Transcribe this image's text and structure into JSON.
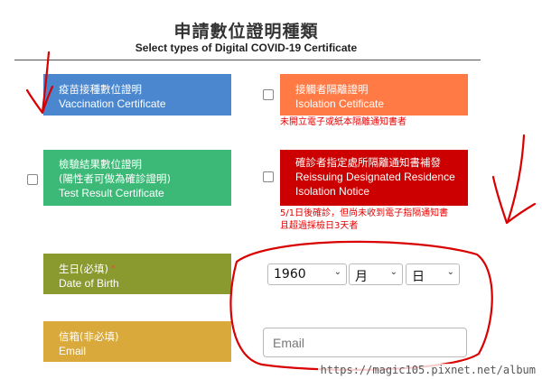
{
  "header": {
    "title_zh": "申請數位證明種類",
    "title_en": "Select types of Digital COVID-19 Certificate"
  },
  "certificates": {
    "vaccination": {
      "zh": "疫苗接種數位證明",
      "en": "Vaccination Certificate",
      "color": "#4a87cf"
    },
    "isolation": {
      "zh": "接觸者隔離證明",
      "en": "Isolation Cetificate",
      "color": "#ff7a45",
      "note": "未開立電子或紙本隔離通知書者"
    },
    "test_result": {
      "zh_line1": "檢驗結果數位證明",
      "zh_line2": "(陽性者可做為確診證明)",
      "en": "Test Result Certificate",
      "color": "#3cb977"
    },
    "reissue": {
      "zh": "確診者指定處所隔離通知書補發",
      "en_line1": "Reissuing Designated Residence",
      "en_line2": "Isolation Notice",
      "color": "#cc0000",
      "note_line1": "5/1日後確診，但尚未收到電子指隔通知書",
      "note_line2": "且超過採檢日3天者"
    }
  },
  "birth": {
    "label_zh": "生日(必填)",
    "required_mark": "*",
    "label_en": "Date of Birth",
    "year": "1960",
    "month": "月",
    "day": "日",
    "color": "#8a9a2f"
  },
  "email": {
    "label_zh": "信箱(非必填)",
    "label_en": "Email",
    "placeholder": "Email",
    "color": "#d9a93b"
  },
  "watermark": "https://magic105.pixnet.net/album"
}
